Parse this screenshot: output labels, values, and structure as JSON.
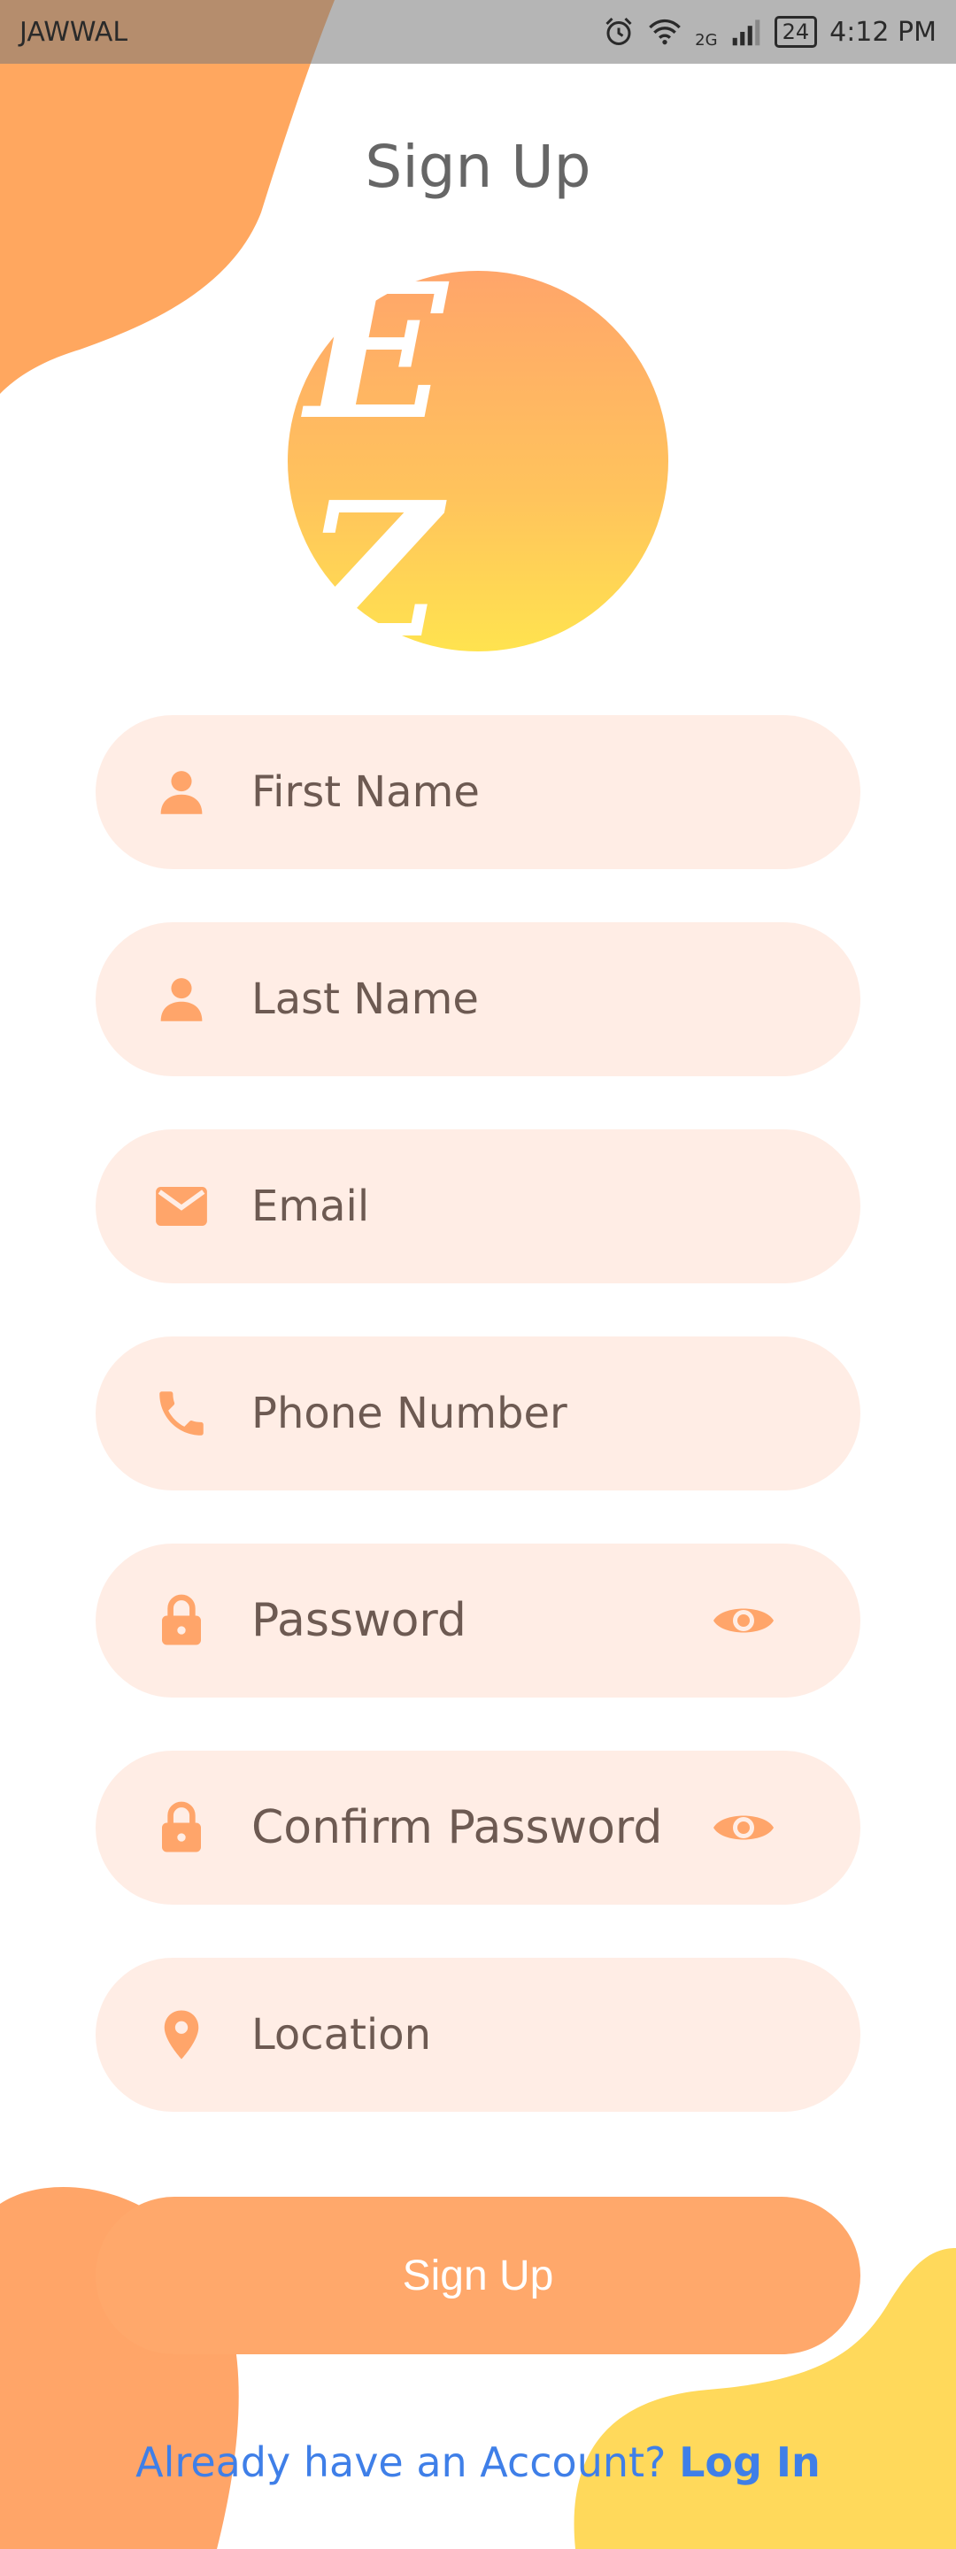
{
  "status_bar": {
    "carrier": "JAWWAL",
    "network": "2G",
    "battery": "24",
    "time": "4:12 PM"
  },
  "header": {
    "title": "Sign Up"
  },
  "logo": {
    "text": "E Z"
  },
  "form": {
    "fields": [
      {
        "label": "First Name",
        "icon": "person-icon"
      },
      {
        "label": "Last Name",
        "icon": "person-icon"
      },
      {
        "label": "Email",
        "icon": "email-icon"
      },
      {
        "label": "Phone Number",
        "icon": "phone-icon"
      },
      {
        "label": "Password",
        "icon": "lock-icon",
        "toggle": "eye-icon"
      },
      {
        "label": "Confirm Password",
        "icon": "lock-icon",
        "toggle": "eye-icon"
      },
      {
        "label": "Location",
        "icon": "location-pin-icon"
      }
    ],
    "submit_label": "Sign Up"
  },
  "footer": {
    "prompt": "Already have an Account?",
    "link_label": "Log In"
  },
  "colors": {
    "accent": "#ffa86b",
    "field_bg": "#ffede5",
    "link": "#3f7fe8",
    "yellow_blob": "#ffd95b"
  }
}
